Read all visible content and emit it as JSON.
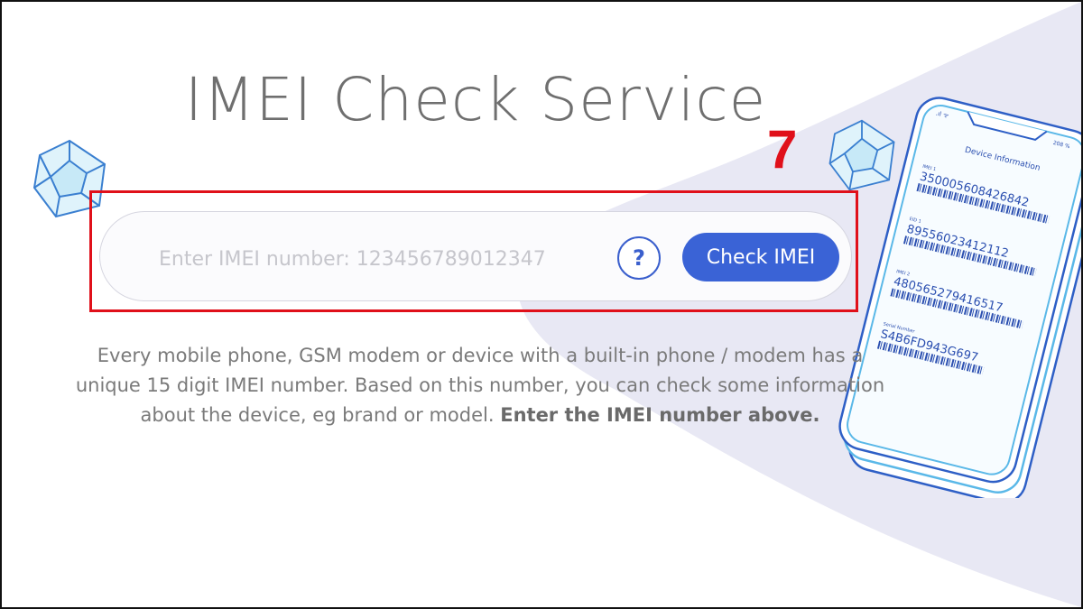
{
  "page": {
    "title": "IMEI Check Service",
    "step_number": "7"
  },
  "search": {
    "placeholder": "Enter IMEI number: 123456789012347",
    "help_label": "?",
    "button_label": "Check IMEI"
  },
  "description": {
    "line1": "Every mobile phone, GSM modem or device with a built-in phone / modem has a",
    "line2": "unique 15 digit IMEI number. Based on this number, you can check some information",
    "line3_plain": "about the device, eg brand or model.",
    "line3_bold": "Enter the IMEI number above."
  },
  "phone_illustration": {
    "status_time": "208 %",
    "header": "Device Information",
    "fields": [
      {
        "label": "IMEI 1",
        "value": "350005608426842"
      },
      {
        "label": "EID 1",
        "value": "89556023412112"
      },
      {
        "label": "IMEI 2",
        "value": "480565279416517"
      },
      {
        "label": "Serial Number",
        "value": "S4B6FD943G697"
      }
    ]
  },
  "colors": {
    "accent": "#3a63d6",
    "highlight": "#e0101a",
    "blob": "#e8e8f4",
    "phone_outline": "#5ab8e8"
  }
}
